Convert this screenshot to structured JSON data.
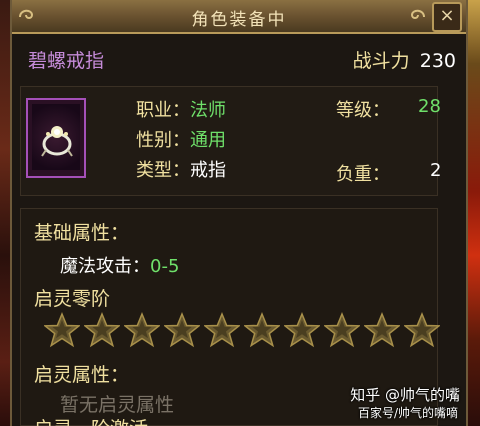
{
  "window": {
    "title": "角色装备中",
    "close_symbol": "×"
  },
  "item": {
    "name": "碧螺戒指",
    "power_label": "战斗力",
    "power_value": "230",
    "icon": "ring-icon"
  },
  "attributes": {
    "class_label": "职业：",
    "class_value": "法师",
    "gender_label": "性别：",
    "gender_value": "通用",
    "type_label": "类型：",
    "type_value": "戒指",
    "level_label": "等级：",
    "level_value": "28",
    "weight_label": "负重：",
    "weight_value": "2"
  },
  "base_section": {
    "title": "基础属性：",
    "stat_label": "魔法攻击：",
    "stat_value": "0-5"
  },
  "stage_section": {
    "title": "启灵零阶",
    "stars_filled": 0,
    "stars_total": 10
  },
  "spirit_section": {
    "title": "启灵属性：",
    "empty_text": "暂无启灵属性",
    "cut_off_text": "启灵一阶激活"
  },
  "watermarks": {
    "line1": "知乎 @帅气的嘴",
    "line2": "百家号/帅气的嘴嘀"
  },
  "colors": {
    "item_name": "#c58bd8",
    "label": "#f0e0a0",
    "green_value": "#6fe06a",
    "frame_purple": "#a550b8"
  }
}
